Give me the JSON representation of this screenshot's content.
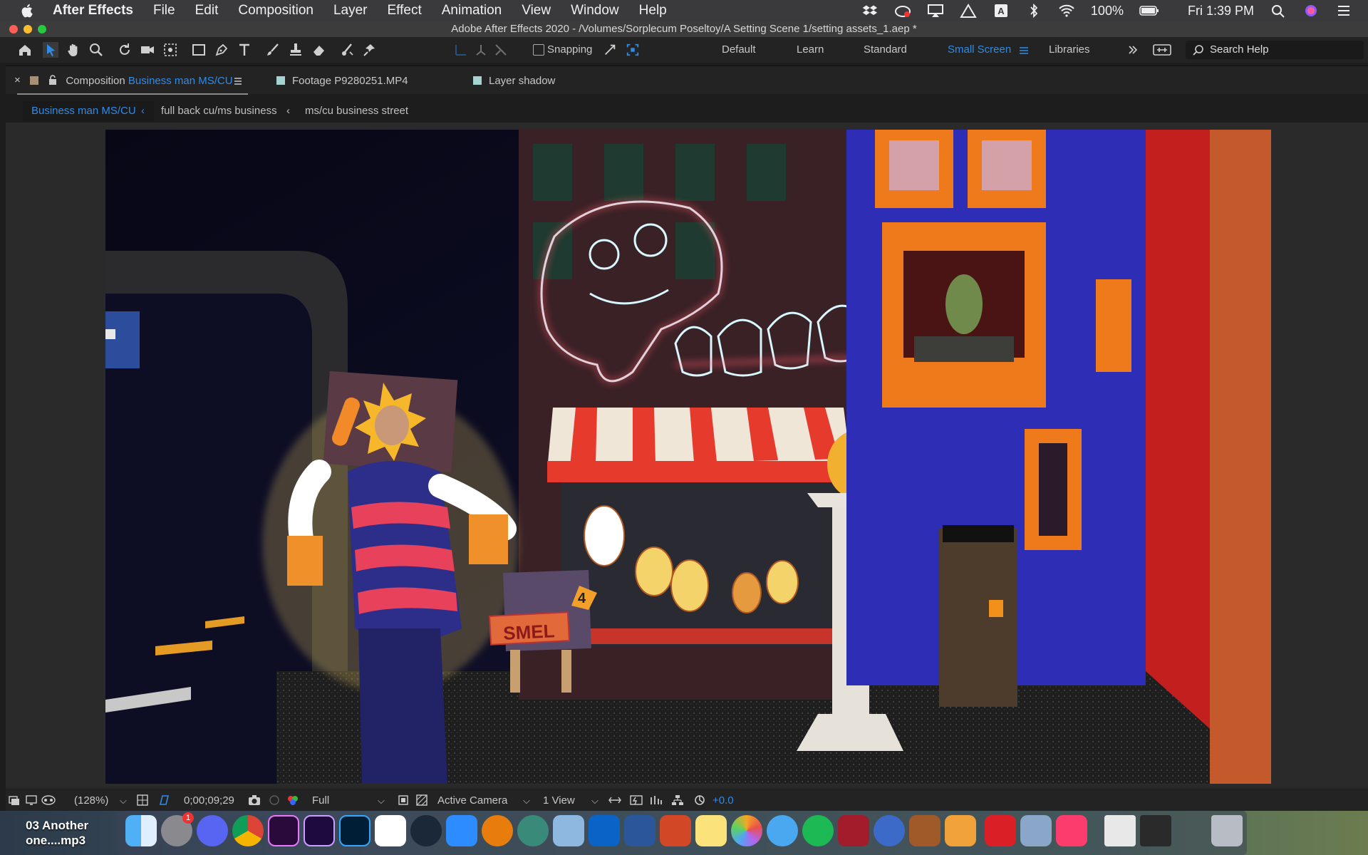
{
  "menubar": {
    "app_name": "After Effects",
    "items": [
      "File",
      "Edit",
      "Composition",
      "Layer",
      "Effect",
      "Animation",
      "View",
      "Window",
      "Help"
    ],
    "battery": "100%",
    "clock": "Fri 1:39 PM"
  },
  "window": {
    "title": "Adobe After Effects 2020 - /Volumes/Sorplecum Poseltoy/A Setting Scene 1/setting assets_1.aep *"
  },
  "toolbar": {
    "snapping_label": "Snapping",
    "workspaces": [
      "Default",
      "Learn",
      "Standard",
      "Small Screen",
      "Libraries"
    ],
    "active_workspace": "Small Screen",
    "search_placeholder": "Search Help"
  },
  "panel_tabs": {
    "composition_prefix": "Composition",
    "composition_name": "Business man MS/CU",
    "footage": "Footage P9280251.MP4",
    "layer": "Layer shadow"
  },
  "breadcrumbs": [
    "Business man MS/CU",
    "full back cu/ms business",
    "ms/cu business street"
  ],
  "viewer": {
    "sign_text": "SMEL",
    "sign_number": "4"
  },
  "viewer_bar": {
    "zoom": "(128%)",
    "timecode": "0;00;09;29",
    "resolution": "Full",
    "camera": "Active Camera",
    "views": "1 View",
    "exposure": "+0.0"
  },
  "desktop": {
    "file_label": "03 Another one....mp3"
  },
  "dock": {
    "badge": "1",
    "items": [
      "finder-icon",
      "system-preferences-icon",
      "discord-icon",
      "chrome-icon",
      "premiere-icon",
      "after-effects-icon",
      "photoshop-icon",
      "slack-icon",
      "steam-icon",
      "zoom-icon",
      "blender-icon",
      "app-icon",
      "preview-icon",
      "outlook-icon",
      "word-icon",
      "powerpoint-icon",
      "notes-icon",
      "photos-icon",
      "messages-icon",
      "spotify-icon",
      "photo-booth-icon",
      "quicktime-icon",
      "instruments-icon",
      "fontlab-icon",
      "creative-cloud-icon",
      "image-capture-icon",
      "music-icon",
      "chrome-window-icon",
      "premiere-window-icon",
      "trash-icon"
    ]
  },
  "colors": {
    "accent_blue": "#2d8ceb",
    "menubar": "#3a3a3c",
    "panel": "#232323"
  }
}
